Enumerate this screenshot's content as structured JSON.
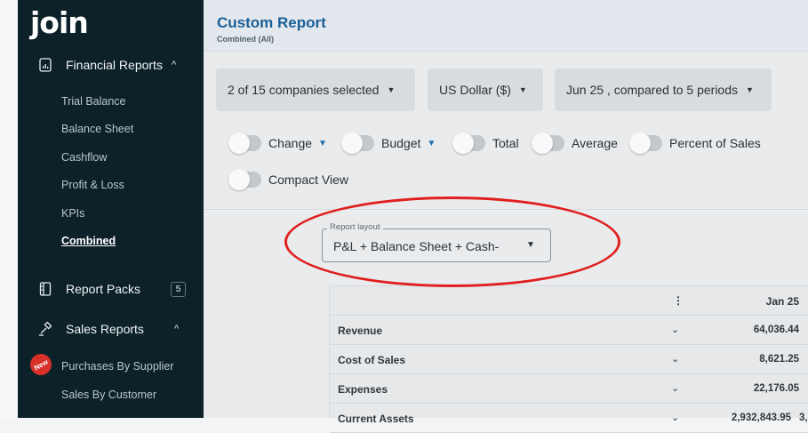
{
  "app": {
    "logo": "join"
  },
  "sidebar": {
    "financial": {
      "label": "Financial Reports",
      "chevron": "^"
    },
    "sub_items": [
      "Trial Balance",
      "Balance Sheet",
      "Cashflow",
      "Profit & Loss",
      "KPIs",
      "Combined"
    ],
    "active_item": "Combined",
    "report_packs": {
      "label": "Report Packs",
      "count": "5"
    },
    "sales": {
      "label": "Sales Reports",
      "chevron": "^"
    },
    "sales_items": [
      "Purchases By Supplier",
      "Sales By Customer"
    ],
    "new_badge": "New"
  },
  "header": {
    "title": "Custom Report",
    "subtitle": "Combined (All)"
  },
  "filters": {
    "companies": "2 of 15 companies selected",
    "currency": "US Dollar ($)",
    "period": "Jun 25 , compared to 5 periods"
  },
  "toggles": [
    {
      "label": "Change",
      "caret": "▼",
      "on": false
    },
    {
      "label": "Budget",
      "caret": "▼",
      "on": false
    },
    {
      "label": "Total",
      "on": false
    },
    {
      "label": "Average",
      "on": false
    },
    {
      "label": "Percent of Sales",
      "on": false
    },
    {
      "label": "Compact View",
      "on": false
    }
  ],
  "report_layout": {
    "legend": "Report layout",
    "value": "P&L + Balance Sheet + Cash-"
  },
  "table": {
    "column_header": "Jan 25",
    "menu_glyph": "⋮",
    "expand_glyph": "⌄",
    "rows": [
      {
        "name": "Revenue",
        "value": "64,036.44"
      },
      {
        "name": "Cost of Sales",
        "value": "8,621.25"
      },
      {
        "name": "Expenses",
        "value": "22,176.05"
      },
      {
        "name": "Current Assets",
        "value": "2,932,843.95",
        "next_col_partial": "3,"
      }
    ]
  },
  "colors": {
    "sidebar_bg": "#0d2129",
    "title_blue": "#1b5f97",
    "annotation_red": "#e0201f",
    "toggle_caret_blue": "#1f6fb3"
  }
}
